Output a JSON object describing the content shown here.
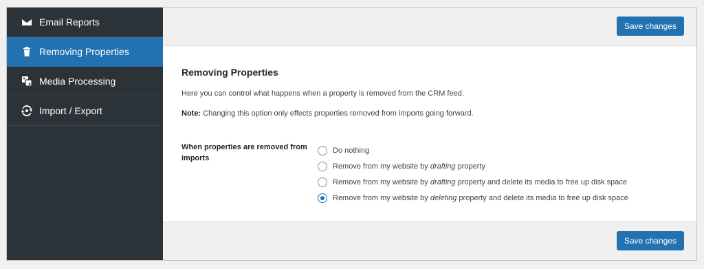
{
  "sidebar": {
    "items": [
      {
        "label": "Email Reports",
        "icon": "envelope-icon",
        "active": false
      },
      {
        "label": "Removing Properties",
        "icon": "trash-icon",
        "active": true
      },
      {
        "label": "Media Processing",
        "icon": "images-icon",
        "active": false
      },
      {
        "label": "Import / Export",
        "icon": "refresh-icon",
        "active": false
      }
    ]
  },
  "toolbar": {
    "save_label": "Save changes"
  },
  "content": {
    "title": "Removing Properties",
    "description": "Here you can control what happens when a property is removed from the CRM feed.",
    "note_label": "Note:",
    "note_text": " Changing this option only effects properties removed from imports going forward.",
    "field_label": "When properties are removed from imports",
    "options": [
      {
        "before": "Do nothing",
        "em": "",
        "after": "",
        "checked": false
      },
      {
        "before": "Remove from my website by ",
        "em": "drafting",
        "after": " property",
        "checked": false
      },
      {
        "before": "Remove from my website by ",
        "em": "drafting",
        "after": " property and delete its media to free up disk space",
        "checked": false
      },
      {
        "before": "Remove from my website by ",
        "em": "deleting",
        "after": " property and delete its media to free up disk space",
        "checked": true
      }
    ]
  },
  "colors": {
    "sidebar_bg": "#2c3338",
    "accent": "#2271b1",
    "page_bg": "#f0f0f1"
  }
}
